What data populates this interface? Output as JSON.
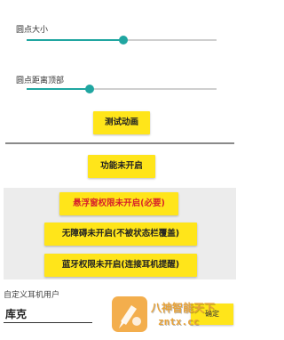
{
  "settings": {
    "dot_size_label": "圆点大小",
    "dot_size_value": 0.51,
    "dot_top_distance_label": "圆点距离顶部",
    "dot_top_distance_value": 0.33,
    "test_animation_button": "测试动画",
    "function_status_button": "功能未开启"
  },
  "permissions": {
    "overlay_button": "悬浮窗权限未开启(必要)",
    "accessibility_button": "无障碍未开启(不被状态栏覆盖)",
    "bluetooth_button": "蓝牙权限未开启(连接耳机提醒)"
  },
  "custom_user": {
    "label": "自定义耳机用户",
    "input_value": "库克",
    "confirm_button": "确定"
  },
  "watermark": {
    "name": "八神智能天下",
    "url": "zntx.cc"
  },
  "colors": {
    "accent": "#20a6a1",
    "button_bg": "#ffe51a",
    "warning_text": "#d8232a",
    "panel_bg": "#ececec"
  }
}
